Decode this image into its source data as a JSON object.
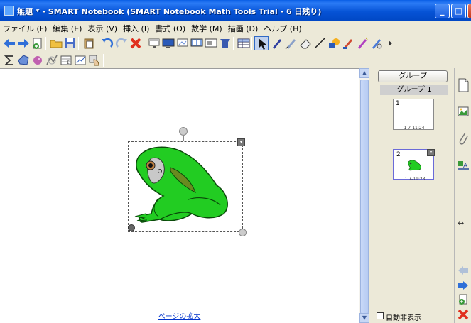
{
  "window": {
    "title": "無題 * - SMART Notebook (SMART Notebook Math Tools Trial - 6 日残り)",
    "minimize": "_",
    "maximize": "□",
    "close": "×"
  },
  "menu": [
    "ファイル (F)",
    "編集 (E)",
    "表示 (V)",
    "挿入 (I)",
    "書式 (O)",
    "数学 (M)",
    "描画 (D)",
    "ヘルプ (H)"
  ],
  "canvas": {
    "zoom_link": "ページの拡大",
    "object_menu_glyph": "▾"
  },
  "sorter": {
    "group_button": "グループ",
    "group_header": "グループ 1",
    "pages": [
      {
        "number": "1",
        "time": "1 7-11:24"
      },
      {
        "number": "2",
        "time": "1 7-11:23"
      }
    ],
    "autohide_label": "自動非表示"
  },
  "scroll": {
    "up": "▲",
    "down": "▼"
  },
  "tabbar": {
    "expand_glyph": "↔"
  },
  "colors": {
    "titlebar": "#0653d6",
    "frog_green": "#22cc22",
    "link": "#0033cc"
  }
}
